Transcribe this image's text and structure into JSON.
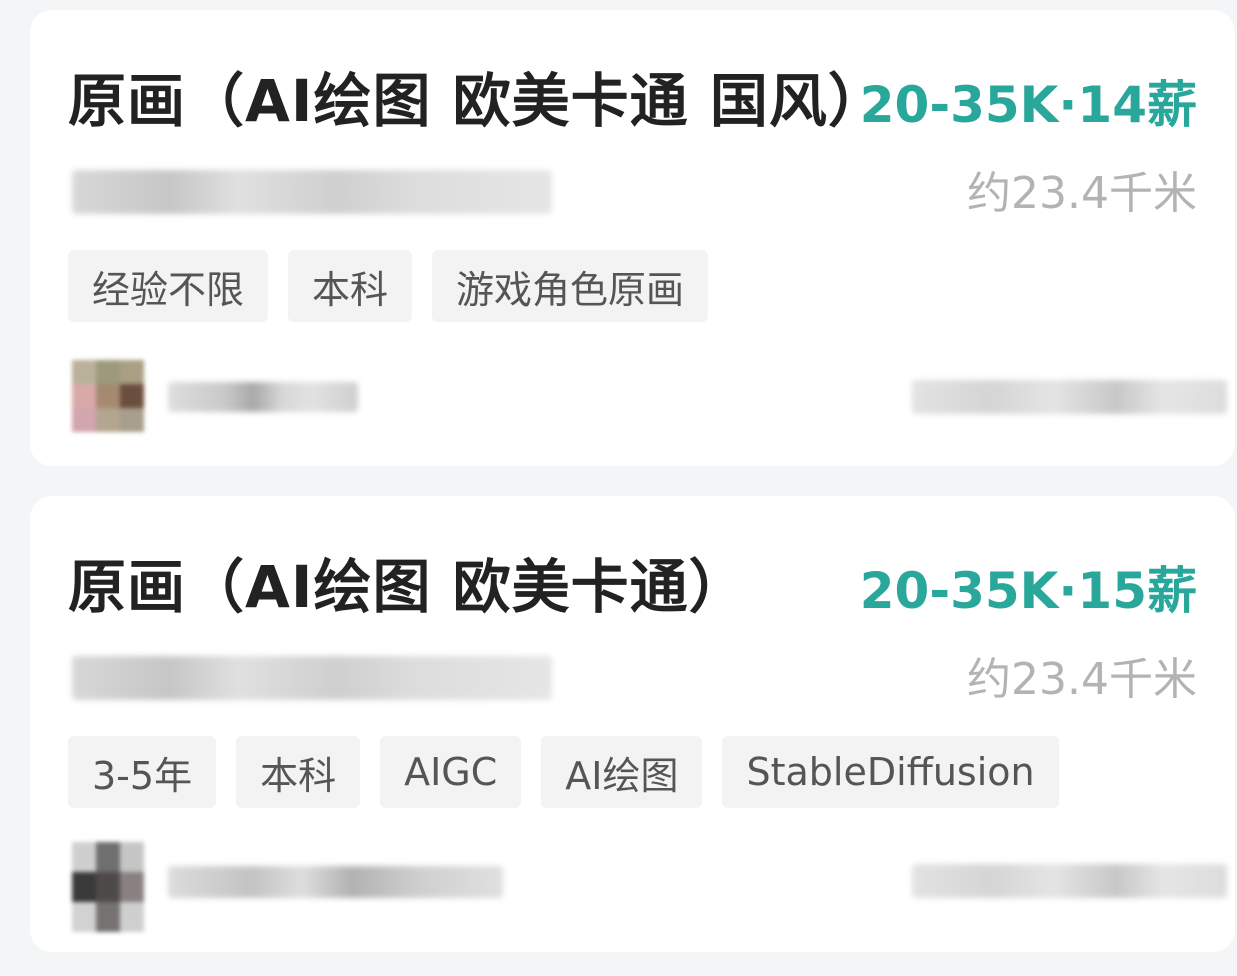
{
  "jobs": [
    {
      "title": "原画（AI绘图 欧美卡通 国风）",
      "salary": "20-35K·14薪",
      "distance": "约23.4千米",
      "tags": [
        "经验不限",
        "本科",
        "游戏角色原画"
      ]
    },
    {
      "title": "原画（AI绘图 欧美卡通）",
      "salary": "20-35K·15薪",
      "distance": "约23.4千米",
      "tags": [
        "3-5年",
        "本科",
        "AIGC",
        "AI绘图",
        "StableDiffusion"
      ]
    }
  ],
  "colors": {
    "salary": "#2aa79b",
    "title": "#222222",
    "distance": "#b3b3b3",
    "tag_bg": "#f3f3f3",
    "tag_text": "#555555",
    "card_bg": "#ffffff",
    "page_bg": "#f4f5f7"
  }
}
